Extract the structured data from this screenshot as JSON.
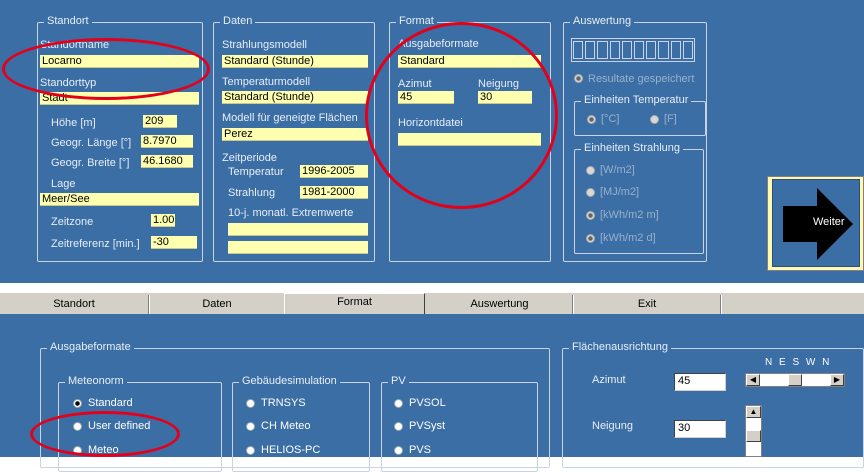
{
  "standort": {
    "title": "Standort",
    "standortname_label": "Standortname",
    "standortname_value": "Locarno",
    "standorttyp_label": "Standorttyp",
    "standorttyp_value": "Stadt",
    "hoehe_label": "Höhe [m]",
    "hoehe_value": "209",
    "laenge_label": "Geogr. Länge [°]",
    "laenge_value": "8.7970",
    "breite_label": "Geogr. Breite [°]",
    "breite_value": "46.1680",
    "lage_label": "Lage",
    "lage_value": "Meer/See",
    "zeitzone_label": "Zeitzone",
    "zeitzone_value": "1.00",
    "zeitreferenz_label": "Zeitreferenz [min.]",
    "zeitreferenz_value": "-30"
  },
  "daten": {
    "title": "Daten",
    "strahlungsmodell_label": "Strahlungsmodell",
    "strahlungsmodell_value": "Standard (Stunde)",
    "temperaturmodell_label": "Temperaturmodell",
    "temperaturmodell_value": "Standard (Stunde)",
    "modell_label": "Modell für geneigte Flächen",
    "modell_value": "Perez",
    "zeitperiode_label": "Zeitperiode",
    "temperatur_label": "Temperatur",
    "temperatur_value": "1996-2005",
    "strahlung_label": "Strahlung",
    "strahlung_value": "1981-2000",
    "extrem_label": "10-j. monatl. Extremwerte"
  },
  "format": {
    "title": "Format",
    "ausgabeformate_label": "Ausgabeformate",
    "ausgabeformate_value": "Standard",
    "azimut_label": "Azimut",
    "azimut_value": "45",
    "neigung_label": "Neigung",
    "neigung_value": "30",
    "horizontdatei_label": "Horizontdatei"
  },
  "auswertung": {
    "title": "Auswertung",
    "resultate_label": "Resultate gespeichert",
    "temp_units_title": "Einheiten Temperatur",
    "temp_units": [
      "[°C]",
      "[F]"
    ],
    "strahlung_units_title": "Einheiten Strahlung",
    "strahlung_units": [
      "[W/m2]",
      "[MJ/m2]",
      "[kWh/m2 m]",
      "[kWh/m2 d]"
    ],
    "next_label": "Weiter"
  },
  "tabs": [
    "Standort",
    "Daten",
    "Format",
    "Auswertung",
    "Exit"
  ],
  "bottom": {
    "ausgabeformate_title": "Ausgabeformate",
    "meteonorm_title": "Meteonorm",
    "meteonorm_options": [
      "Standard",
      "User defined",
      "Meteo"
    ],
    "gebaeude_title": "Gebäudesimulation",
    "gebaeude_options": [
      "TRNSYS",
      "CH Meteo",
      "HELIOS-PC"
    ],
    "pv_title": "PV",
    "pv_options": [
      "PVSOL",
      "PVSyst",
      "PVS"
    ],
    "flaechen_title": "Flächenausrichtung",
    "azimut_label": "Azimut",
    "azimut_value": "45",
    "neigung_label": "Neigung",
    "neigung_value": "30",
    "compass": "N E S W N"
  },
  "colors": {
    "panel_bg": "#3a6ea5",
    "field_bg": "#ffffb0",
    "annotation": "#e3001b"
  }
}
